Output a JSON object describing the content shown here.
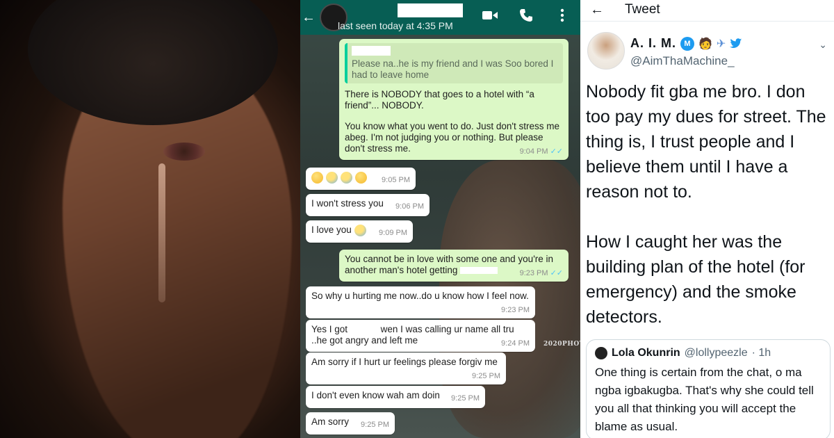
{
  "photo": {
    "alt_semantic": "man-crying-photo"
  },
  "chat": {
    "header": {
      "last_seen": "last seen today at 4:35 PM",
      "icons": [
        "back-arrow-icon",
        "video-call-icon",
        "phone-call-icon",
        "more-vert-icon"
      ]
    },
    "messages": [
      {
        "dir": "out",
        "quote_text": "Please na..he is my friend and I was Soo bored I had to leave home",
        "para1": "There is NOBODY that goes to a hotel with “a friend”... NOBODY.",
        "para2": "You know what you went to do. Just don't stress me abeg. I'm not judging you or nothing. But please don't stress me.",
        "time": "9:04 PM"
      },
      {
        "dir": "in",
        "text": "",
        "time": "9:05 PM"
      },
      {
        "dir": "in",
        "text": "I won't stress you",
        "time": "9:06 PM"
      },
      {
        "dir": "in",
        "text": "I love you",
        "time": "9:09 PM"
      },
      {
        "dir": "out",
        "text": "You cannot be in love with some one and you're in another man's hotel getting",
        "time": "9:23 PM"
      },
      {
        "dir": "in",
        "text": "So why u hurting me now..do u know how I feel now.",
        "time": "9:23 PM"
      },
      {
        "dir": "in",
        "text_a": "Yes I got",
        "text_b": "wen I was calling ur name all tru ..he got angry and left me",
        "time": "9:24 PM"
      },
      {
        "dir": "in",
        "text": "Am sorry if I hurt ur feelings please forgiv me",
        "time": "9:25 PM"
      },
      {
        "dir": "in",
        "text": "I don't even know wah am doin",
        "time": "9:25 PM"
      },
      {
        "dir": "in",
        "text": "Am sorry",
        "time": "9:25 PM"
      }
    ],
    "watermark": "2020PHOT"
  },
  "tweet": {
    "header_label": "Tweet",
    "author_name": "A. I. M.",
    "badge_letter": "M",
    "handle": "@AimThaMachine_",
    "body_p1": "Nobody fit gba me bro. I don too pay my dues for street. The thing is, I trust people and I believe them until I have a reason not to.",
    "body_p2": "How I caught her was the building plan of the hotel (for emergency) and the smoke detectors.",
    "quoted": {
      "name": "Lola Okunrin",
      "handle": "@lollypeezle",
      "time": "· 1h",
      "text": "One thing is certain from the chat, o ma ngba igbakugba. That's why she could tell you all that thinking you will accept the blame as usual."
    }
  },
  "colors": {
    "whatsapp_header": "#075e54",
    "outgoing_bubble": "#dcf8c6",
    "incoming_bubble": "#ffffff",
    "read_ticks": "#4fc3f7",
    "twitter_blue": "#1d9bf0"
  }
}
